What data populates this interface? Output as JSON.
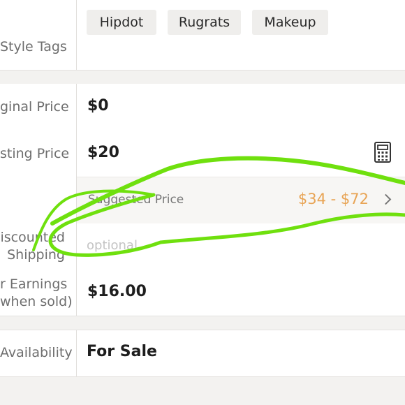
{
  "style_tags": {
    "label": "Style Tags",
    "tags": [
      "Hipdot",
      "Rugrats",
      "Makeup"
    ]
  },
  "original_price": {
    "label": "ginal Price",
    "value": "$0"
  },
  "listing_price": {
    "label": "sting Price",
    "value": "$20",
    "calculator_icon": "calculator-icon"
  },
  "suggested_price": {
    "label": "Suggested Price",
    "range": "$34 - $72",
    "chevron_icon": "chevron-right-icon"
  },
  "discounted_shipping": {
    "label_line1": "iscounted",
    "label_line2": "Shipping",
    "placeholder": "optional"
  },
  "earnings": {
    "label_line1": "r Earnings",
    "label_line2": "when sold)",
    "value": "$16.00"
  },
  "availability": {
    "label": "Availability",
    "value": "For Sale"
  },
  "colors": {
    "accent_orange": "#e8a455",
    "scribble_green": "#6fe00e"
  }
}
